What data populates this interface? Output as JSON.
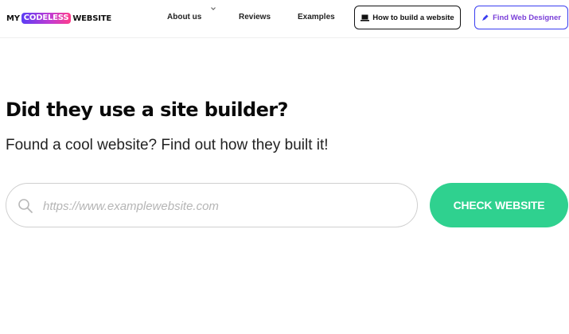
{
  "logo": {
    "left": "MY",
    "middle": "CODELESS",
    "right": "WEBSITE"
  },
  "nav": {
    "about": "About us",
    "reviews": "Reviews",
    "examples": "Examples"
  },
  "buttons": {
    "how_to": "How to build a website",
    "how_to_icon": "laptop-icon",
    "designer": "Find Web Designer",
    "designer_icon": "paintbrush-icon"
  },
  "hero": {
    "headline": "Did they use a site builder?",
    "subhead": "Found a cool website? Find out how they built it!"
  },
  "search": {
    "placeholder": "https://www.examplewebsite.com",
    "value": "",
    "icon": "search-icon",
    "submit_label": "CHECK WEBSITE"
  },
  "colors": {
    "accent_green": "#2fd18f",
    "designer_border": "#3a3df0",
    "designer_text": "#7a3fd8"
  }
}
